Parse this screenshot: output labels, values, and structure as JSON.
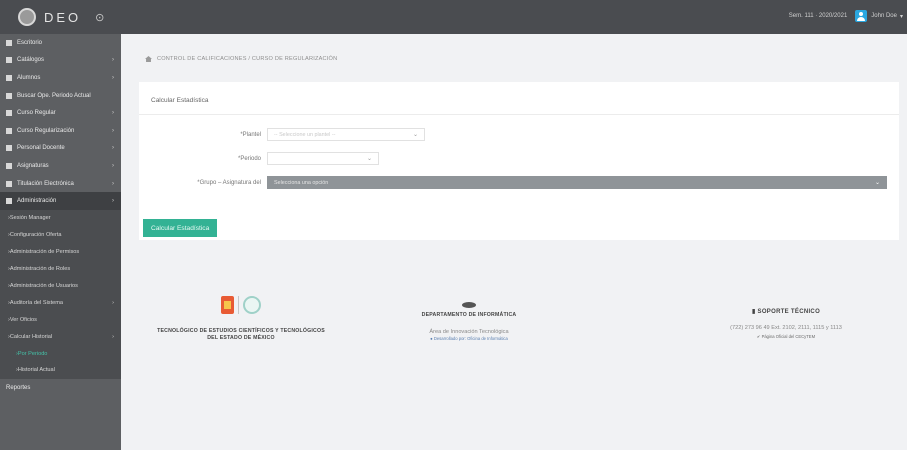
{
  "app": {
    "brand": "DEO",
    "toggle_icon": "circle-toggle-icon"
  },
  "topbar": {
    "session_info": "Sem. 111 · 2020/2021",
    "user_name": "John Doe"
  },
  "sidebar": {
    "items": [
      {
        "label": "Escritorio",
        "icon": "dashboard-icon",
        "has_chevron": false
      },
      {
        "label": "Catálogos",
        "icon": "catalog-icon",
        "has_chevron": true
      },
      {
        "label": "Alumnos",
        "icon": "students-icon",
        "has_chevron": true
      },
      {
        "label": "Buscar Ope. Periodo Actual",
        "icon": "search-icon",
        "has_chevron": false
      },
      {
        "label": "Curso Regular",
        "icon": "course-icon",
        "has_chevron": true
      },
      {
        "label": "Curso Regularización",
        "icon": "course-reg-icon",
        "has_chevron": true
      },
      {
        "label": "Personal Docente",
        "icon": "teacher-icon",
        "has_chevron": true
      },
      {
        "label": "Asignaturas",
        "icon": "book-icon",
        "has_chevron": true
      },
      {
        "label": "Titulación Electrónica",
        "icon": "diploma-icon",
        "has_chevron": true
      },
      {
        "label": "Administración",
        "icon": "admin-icon",
        "has_chevron": true
      }
    ],
    "admin_sub": [
      {
        "label": "Sesión Manager",
        "has_chevron": false
      },
      {
        "label": "Configuración Oferta",
        "has_chevron": false
      },
      {
        "label": "Administración de Permisos",
        "has_chevron": false
      },
      {
        "label": "Administración de Roles",
        "has_chevron": false
      },
      {
        "label": "Administración de Usuarios",
        "has_chevron": false
      },
      {
        "label": "Auditoría del Sistema",
        "has_chevron": true
      },
      {
        "label": "Ver Oficios",
        "has_chevron": false
      },
      {
        "label": "Calcular Historial",
        "has_chevron": true
      }
    ],
    "calc_sub": [
      {
        "label": "Por Periodo"
      },
      {
        "label": "Historial Actual"
      }
    ],
    "last_item": "Reportes"
  },
  "breadcrumb": "CONTROL DE CALIFICACIONES / CURSO DE REGULARIZACIÓN",
  "card": {
    "title": "Calcular Estadística",
    "fields": [
      {
        "label": "*Plantel",
        "value": "",
        "placeholder": "-- Seleccione un plantel --"
      },
      {
        "label": "*Periodo",
        "value": "",
        "placeholder": ""
      },
      {
        "label": "*Grupo – Asignatura del",
        "value": "Selecciona una opción",
        "placeholder": ""
      }
    ],
    "button_label": "Calcular Estadística"
  },
  "footer": {
    "left": {
      "line1": "TECNOLÓGICO DE ESTUDIOS CIENTÍFICOS Y TECNOLÓGICOS",
      "line2": "DEL ESTADO DE MÉXICO"
    },
    "center": {
      "title": "DEPARTAMENTO DE INFORMÁTICA",
      "line": "Área de Innovación Tecnológica",
      "small": "● Desarrollado por: Oficina de Informática"
    },
    "right": {
      "title": "SOPORTE TÉCNICO",
      "phone": "(722) 273 96 49 Ext. 2102, 2111, 1115 y 1113",
      "link": "✔ Página Oficial del CECyTEM"
    }
  },
  "colors": {
    "accent": "#33b294",
    "sidebar": "#5d5f62",
    "topbar": "#4a4c50"
  }
}
